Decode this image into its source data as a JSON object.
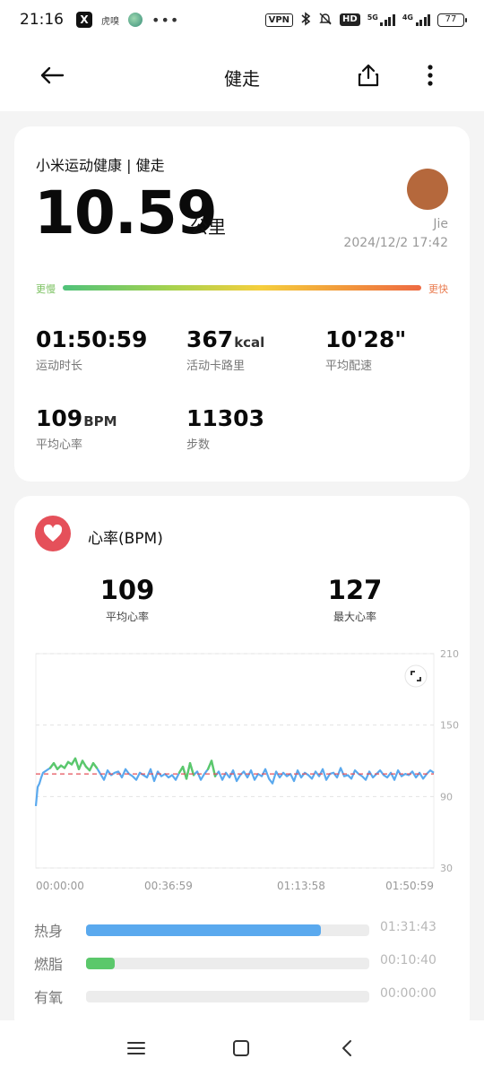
{
  "status_bar": {
    "time": "21:16",
    "app_x": "X",
    "app_text": "虎嗅",
    "more": "•••",
    "vpn": "VPN",
    "hd": "HD",
    "net1": "5G",
    "net2": "4G",
    "battery": "77"
  },
  "app_bar": {
    "title": "健走"
  },
  "summary": {
    "source": "小米运动健康 | 健走",
    "distance": "10.59",
    "distance_unit": "公里",
    "user_name": "Jie",
    "datetime": "2024/12/2 17:42",
    "pace_slow": "更慢",
    "pace_fast": "更快",
    "avatar_color": "#b5683c",
    "stats": [
      {
        "value": "01:50:59",
        "unit": "",
        "label": "运动时长"
      },
      {
        "value": "367",
        "unit": "kcal",
        "label": "活动卡路里"
      },
      {
        "value": "10'28\"",
        "unit": "",
        "label": "平均配速"
      },
      {
        "value": "109",
        "unit": "BPM",
        "label": "平均心率"
      },
      {
        "value": "11303",
        "unit": "",
        "label": "步数"
      }
    ]
  },
  "heart_rate": {
    "title": "心率(BPM)",
    "avg_value": "109",
    "avg_label": "平均心率",
    "max_value": "127",
    "max_label": "最大心率",
    "zones": [
      {
        "name": "热身",
        "time": "01:31:43",
        "fraction": 0.83,
        "color": "#5aa9ee"
      },
      {
        "name": "燃脂",
        "time": "00:10:40",
        "fraction": 0.1,
        "color": "#5bc86b"
      },
      {
        "name": "有氧",
        "time": "00:00:00",
        "fraction": 0.0,
        "color": "#f5b642"
      }
    ]
  },
  "chart_data": {
    "type": "line",
    "title": "",
    "xlabel": "",
    "ylabel": "",
    "y_ticks": [
      "210",
      "150",
      "90",
      "30"
    ],
    "ylim": [
      30,
      210
    ],
    "x_ticks": [
      "00:00:00",
      "00:36:59",
      "01:13:58",
      "01:50:59"
    ],
    "xlim_minutes": [
      0,
      110.98
    ],
    "average_line": 109,
    "average_color": "#e5505a",
    "line_color": "#5aa9ee",
    "above_color": "#5bc86b",
    "above_threshold": 115,
    "series": [
      {
        "x": [
          0,
          0.5,
          1,
          1.5,
          2,
          3,
          4,
          5,
          6,
          7,
          8,
          9,
          10,
          11,
          12,
          13,
          14,
          15,
          16,
          17,
          18,
          19,
          20,
          21,
          22,
          23,
          24,
          25,
          26,
          27,
          28,
          29,
          30,
          31,
          32,
          33,
          34,
          35,
          36,
          37,
          38,
          39,
          40,
          41,
          42,
          43,
          44,
          45,
          46,
          47,
          48,
          49,
          50,
          51,
          52,
          53,
          54,
          55,
          56,
          57,
          58,
          59,
          60,
          61,
          62,
          63,
          64,
          65,
          66,
          67,
          68,
          69,
          70,
          71,
          72,
          73,
          74,
          75,
          76,
          77,
          78,
          79,
          80,
          81,
          82,
          83,
          84,
          85,
          86,
          87,
          88,
          89,
          90,
          91,
          92,
          93,
          94,
          95,
          96,
          97,
          98,
          99,
          100,
          101,
          102,
          103,
          104,
          105,
          106,
          107,
          108,
          109,
          110,
          110.98
        ],
        "y": [
          82,
          98,
          101,
          106,
          110,
          112,
          114,
          118,
          113,
          116,
          114,
          119,
          117,
          122,
          113,
          120,
          115,
          112,
          118,
          114,
          109,
          104,
          112,
          108,
          110,
          111,
          106,
          113,
          109,
          107,
          104,
          110,
          108,
          106,
          113,
          103,
          111,
          107,
          109,
          106,
          108,
          104,
          110,
          115,
          105,
          118,
          108,
          111,
          104,
          109,
          113,
          120,
          107,
          111,
          104,
          110,
          106,
          112,
          103,
          108,
          111,
          106,
          112,
          104,
          109,
          107,
          113,
          105,
          101,
          111,
          106,
          110,
          107,
          109,
          103,
          112,
          106,
          110,
          108,
          105,
          111,
          107,
          113,
          104,
          109,
          110,
          106,
          114,
          107,
          108,
          105,
          112,
          109,
          107,
          104,
          111,
          106,
          109,
          112,
          108,
          106,
          110,
          104,
          112,
          107,
          109,
          108,
          111,
          106,
          110,
          105,
          109,
          112,
          110
        ]
      }
    ],
    "grid": true
  }
}
